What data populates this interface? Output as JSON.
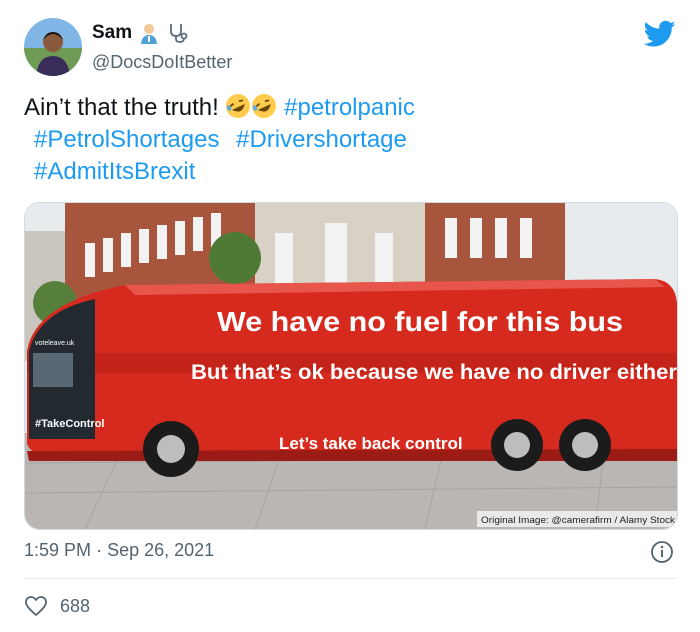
{
  "author": {
    "display_name": "Sam",
    "handle": "@DocsDoItBetter",
    "name_emojis": [
      "health-worker-emoji",
      "stethoscope-emoji"
    ]
  },
  "tweet": {
    "text_start": "Ain’t that the truth!",
    "reaction_emoji": "rolling-on-floor-laughing",
    "hashtags": [
      "#petrolpanic",
      "#PetrolShortages",
      "#Drivershortage",
      "#AdmitItsBrexit"
    ]
  },
  "media": {
    "headline": "We have no fuel for this bus",
    "subline": "But that’s ok because we have no driver either",
    "bus_slogan": "Let’s take back control",
    "bus_hashtag": "#TakeControl",
    "bus_website": "voteleave.uk",
    "credit": "Original Image: @camerafirm / Alamy Stock"
  },
  "meta": {
    "time": "1:59 PM",
    "separator": "·",
    "date": "Sep 26, 2021"
  },
  "actions": {
    "like_count": "688"
  },
  "colors": {
    "twitter_blue": "#1d9bf0",
    "bus_red": "#d62a1e",
    "secondary_text": "#536471"
  }
}
